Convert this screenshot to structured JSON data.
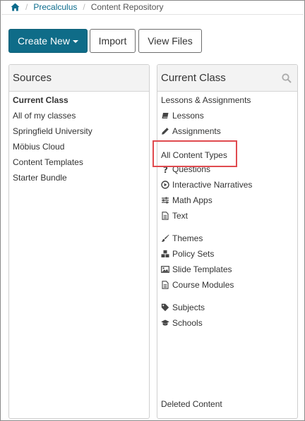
{
  "breadcrumb": {
    "course": "Precalculus",
    "current": "Content Repository"
  },
  "toolbar": {
    "create_new": "Create New",
    "import": "Import",
    "view_files": "View Files"
  },
  "sources": {
    "title": "Sources",
    "items": [
      "Current Class",
      "All of my classes",
      "Springfield University",
      "Möbius Cloud",
      "Content Templates",
      "Starter Bundle"
    ]
  },
  "current_class": {
    "title": "Current Class",
    "top": "Lessons & Assignments",
    "lessons": "Lessons",
    "assignments": "Assignments",
    "all_content_types": "All Content Types",
    "questions": "Questions",
    "interactive_narratives": "Interactive Narratives",
    "math_apps": "Math Apps",
    "text": "Text",
    "themes": "Themes",
    "policy_sets": "Policy Sets",
    "slide_templates": "Slide Templates",
    "course_modules": "Course Modules",
    "subjects": "Subjects",
    "schools": "Schools",
    "deleted_content": "Deleted Content"
  },
  "colors": {
    "accent": "#0f6c88",
    "link": "#0b6b8c",
    "highlight": "#e04a4f"
  }
}
